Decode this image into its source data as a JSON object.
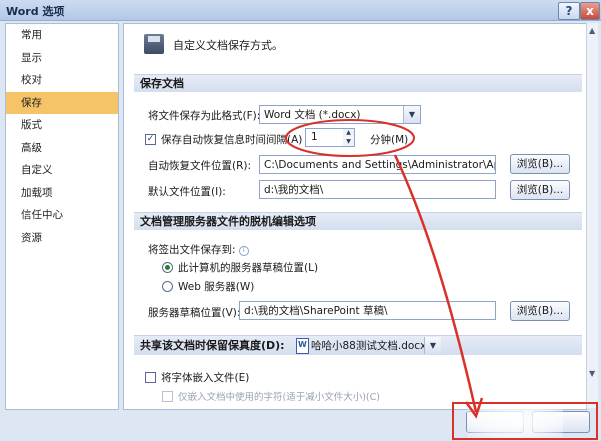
{
  "window": {
    "title": "Word 选项",
    "help_label": "?",
    "close_label": "x"
  },
  "nav": {
    "items": [
      {
        "label": "常用"
      },
      {
        "label": "显示"
      },
      {
        "label": "校对"
      },
      {
        "label": "保存",
        "active": true
      },
      {
        "label": "版式"
      },
      {
        "label": "高级"
      },
      {
        "label": "自定义"
      },
      {
        "label": "加载项"
      },
      {
        "label": "信任中心"
      },
      {
        "label": "资源"
      }
    ]
  },
  "header": {
    "icon": "save-disk-icon",
    "text": "自定义文档保存方式。"
  },
  "save_docs": {
    "title": "保存文档",
    "format_label": "将文件保存为此格式(F):",
    "format_value": "Word 文档 (*.docx)",
    "autorecover_checkbox_label": "保存自动恢复信息时间间隔(A)",
    "autorecover_checked": true,
    "autorecover_minutes": "1",
    "minutes_label": "分钟(M)",
    "autorecover_location_label": "自动恢复文件位置(R):",
    "autorecover_location_value": "C:\\Documents and Settings\\Administrator\\Appli",
    "default_location_label": "默认文件位置(I):",
    "default_location_value": "d:\\我的文档\\",
    "browse_label": "浏览(B)..."
  },
  "offline": {
    "title": "文档管理服务器文件的脱机编辑选项",
    "save_to_label": "将签出文件保存到:",
    "radio_server_drafts": "此计算机的服务器草稿位置(L)",
    "radio_web_server": "Web 服务器(W)",
    "drafts_location_label": "服务器草稿位置(V):",
    "drafts_location_value": "d:\\我的文档\\SharePoint 草稿\\",
    "browse_label": "浏览(B)..."
  },
  "fidelity": {
    "title": "共享该文档时保留保真度(D):",
    "document": "哈哈小88测试文档.docx",
    "embed_fonts_label": "将字体嵌入文件(E)",
    "embed_fonts_checked": false,
    "embed_subset_label": "仅嵌入文档中使用的字符(适于减小文件大小)(C)",
    "embed_subset_checked": false
  },
  "colors": {
    "annotation": "#d9302a",
    "nav_active": "#f6c468",
    "frame": "#dde7f4"
  }
}
